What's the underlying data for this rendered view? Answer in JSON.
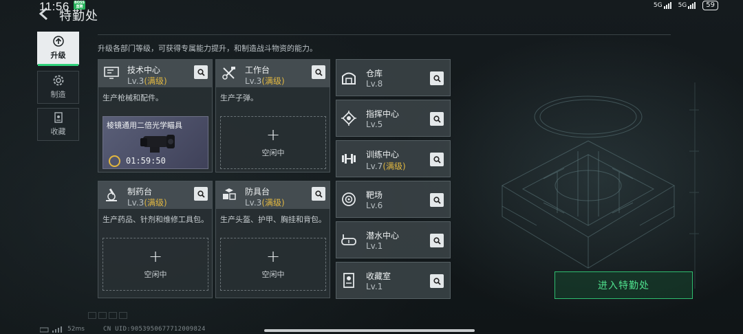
{
  "status": {
    "time": "11:56",
    "badge": "BOSS直聘",
    "net1": "5G",
    "net2": "5G",
    "battery": "59"
  },
  "header": {
    "title": "特勤处"
  },
  "sidebar": {
    "items": [
      {
        "label": "升级",
        "icon": "upgrade-arrow-icon",
        "active": true
      },
      {
        "label": "制造",
        "icon": "gear-icon",
        "active": false
      },
      {
        "label": "收藏",
        "icon": "trophy-cabinet-icon",
        "active": false
      }
    ]
  },
  "description": "升级各部门等级，可获得专属能力提升，和制造战斗物资的能力。",
  "facilities": [
    {
      "name": "技术中心",
      "level": "Lv.3",
      "max": "(满级)",
      "desc": "生产枪械和配件。",
      "icon": "computer-icon",
      "production": {
        "item": "棱镜通用二倍光学瞄具",
        "time": "01:59:50"
      }
    },
    {
      "name": "工作台",
      "level": "Lv.3",
      "max": "(满级)",
      "desc": "生产子弹。",
      "icon": "tools-icon",
      "slot": {
        "plus": "+",
        "label": "空闲中"
      }
    },
    {
      "name": "制药台",
      "level": "Lv.3",
      "max": "(满级)",
      "desc": "生产药品、针剂和维修工具包。",
      "icon": "microscope-icon",
      "slot": {
        "plus": "+",
        "label": "空闲中"
      }
    },
    {
      "name": "防具台",
      "level": "Lv.3",
      "max": "(满级)",
      "desc": "生产头盔、护甲、胸挂和背包。",
      "icon": "armor-boxes-icon",
      "slot": {
        "plus": "+",
        "label": "空闲中"
      }
    }
  ],
  "side_facilities": [
    {
      "name": "仓库",
      "level": "Lv.8",
      "max": "",
      "icon": "warehouse-icon"
    },
    {
      "name": "指挥中心",
      "level": "Lv.5",
      "max": "",
      "icon": "chip-icon"
    },
    {
      "name": "训练中心",
      "level": "Lv.7",
      "max": "(满级)",
      "icon": "dumbbell-icon"
    },
    {
      "name": "靶场",
      "level": "Lv.6",
      "max": "",
      "icon": "target-icon"
    },
    {
      "name": "潜水中心",
      "level": "Lv.1",
      "max": "",
      "icon": "diving-mask-icon"
    },
    {
      "name": "收藏室",
      "level": "Lv.1",
      "max": "",
      "icon": "display-case-icon"
    }
  ],
  "enter_button": "进入特勤处",
  "footer": {
    "ping": "52ms",
    "uid": "CN UID:9053950677712009824"
  },
  "colors": {
    "accent": "#2fd17a",
    "max_level": "#e1b741",
    "enter_text": "#4fe08d"
  }
}
